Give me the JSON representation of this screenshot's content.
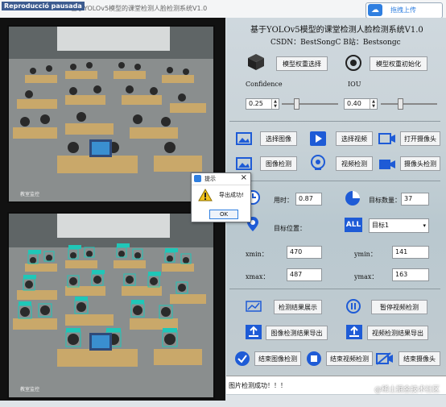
{
  "window": {
    "status_tag": "Reproducció pausada",
    "title": "基于YOLOv5模型的课堂检测人脸检测系统V1.0",
    "upload_label": "拖拽上传"
  },
  "header": {
    "title": "基于YOLOv5模型的课堂检测人脸检测系统V1.0",
    "subtitle": "CSDN：BestSongC  B站：Bestsongc"
  },
  "model": {
    "select_label": "模型权重选择",
    "init_label": "模型权重初始化",
    "confidence_label": "Confidence",
    "confidence_value": "0.25",
    "iou_label": "IOU",
    "iou_value": "0.40"
  },
  "actions": {
    "select_image": "选择图像",
    "select_video": "选择视频",
    "open_camera": "打开摄像头",
    "image_detect": "图像检测",
    "video_detect": "视频检测",
    "camera_detect": "摄像头检测"
  },
  "results": {
    "time_label": "用时：",
    "time_value": "0.87",
    "count_label": "目标数量：",
    "count_value": "37",
    "position_label": "目标位置：",
    "target_select": "目标1",
    "xmin_label": "xmin：",
    "xmin_value": "470",
    "ymin_label": "ymin：",
    "ymin_value": "141",
    "xmax_label": "xmax：",
    "xmax_value": "487",
    "ymax_label": "ymax：",
    "ymax_value": "163"
  },
  "controls": {
    "show_results": "检测结果展示",
    "pause_video": "暂停视频检测",
    "export_image": "图像检测结果导出",
    "export_video": "视频检测结果导出",
    "end_image": "结束图像检测",
    "end_video": "结束视频检测",
    "end_camera": "结束摄像头"
  },
  "dialog": {
    "title": "提示",
    "message": "导出成功!",
    "ok_label": "OK"
  },
  "status": {
    "message": "图片检测成功！！！"
  },
  "watermark": "@稀土掘金技术社区",
  "colors": {
    "accent": "#2f7fe0",
    "detection_box": "#1fc7b8",
    "button_bg": "#f3f4f5"
  }
}
